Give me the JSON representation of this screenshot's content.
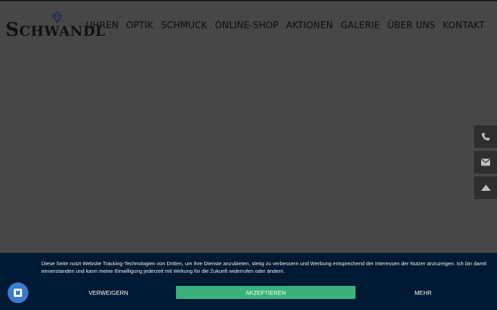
{
  "logo": {
    "first_letter": "S",
    "rest": "CHWANDL"
  },
  "nav": {
    "items": [
      {
        "label": "UHREN"
      },
      {
        "label": "OPTIK"
      },
      {
        "label": "SCHMUCK"
      },
      {
        "label": "ONLINE-SHOP"
      },
      {
        "label": "AKTIONEN"
      },
      {
        "label": "GALERIE"
      },
      {
        "label": "ÜBER UNS"
      },
      {
        "label": "KONTAKT"
      }
    ]
  },
  "side_buttons": {
    "icons": [
      "phone-icon",
      "envelope-icon",
      "arrow-up-icon"
    ]
  },
  "cookie": {
    "text": "Diese Seite nutzt Website Tracking-Technologien von Dritten, um ihre Dienste anzubieten, stetig zu verbessern und Werbung entsprechend der Interessen der Nutzer anzuzeigen. Ich bin damit einverstanden und kann meine Einwilligung jederzeit mit Wirkung für die Zukunft widerrufen oder ändern.",
    "deny_label": "VERWEIGERN",
    "accept_label": "AKZEPTIEREN",
    "more_label": "MEHR",
    "accept_color": "#3ab07a",
    "background": "#001a33"
  },
  "privacy_badge": {
    "icon": "privacy-settings-icon",
    "color": "#3d7bd1"
  }
}
